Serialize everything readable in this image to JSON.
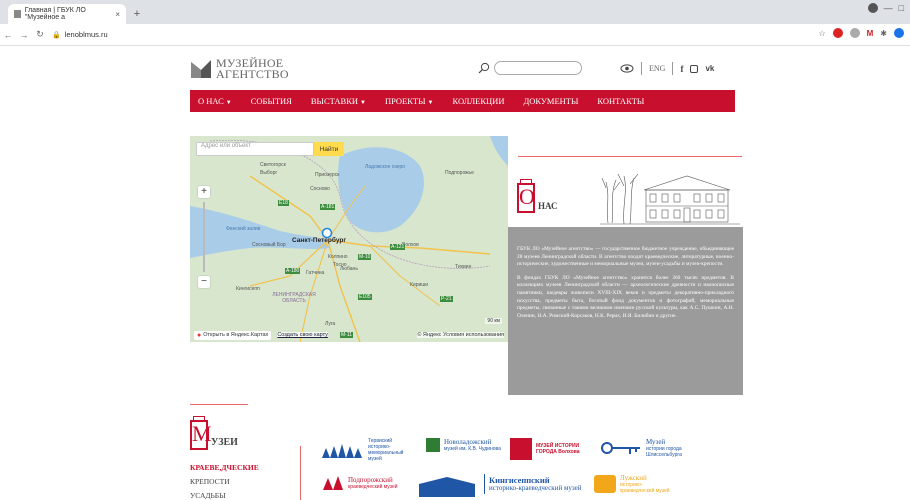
{
  "browser": {
    "tab_title": "Главная | ГБУК ЛО \"Музейное а",
    "tab_close": "×",
    "new_tab": "+",
    "url": "lenoblmus.ru"
  },
  "site": {
    "logo_line1": "МУЗЕЙНОЕ",
    "logo_line2": "АГЕНТСТВО",
    "lang": "ENG",
    "menu": [
      {
        "label": "О НАС",
        "caret": "▼"
      },
      {
        "label": "СОБЫТИЯ",
        "caret": ""
      },
      {
        "label": "ВЫСТАВКИ",
        "caret": "▼"
      },
      {
        "label": "ПРОЕКТЫ",
        "caret": "▼"
      },
      {
        "label": "КОЛЛЕКЦИИ",
        "caret": ""
      },
      {
        "label": "ДОКУМЕНТЫ",
        "caret": ""
      },
      {
        "label": "КОНТАКТЫ",
        "caret": ""
      }
    ]
  },
  "map": {
    "search_placeholder": "Адрес или объект",
    "search_button": "Найти",
    "zoom_in": "+",
    "zoom_out": "−",
    "open_in_yandex": "Открыть в Яндекс.Картах",
    "create_map": "Создать свою карту",
    "copyright": "© Яндекс Условия использования",
    "scale": "90 км",
    "labels": {
      "vyborg": "Выборг",
      "svetogorsk": "Светогорск",
      "sosnovo": "Сосново",
      "priozersk": "Приозерск",
      "ladoga": "Ладожское озеро",
      "podporozhye": "Подпорожье",
      "gulf": "Финский залив",
      "sosnovy_bor": "Сосновый Бор",
      "spb": "Санкт-Петербург",
      "kolpino": "Колпино",
      "lyuban": "Любань",
      "tosno": "Тосно",
      "volkhov": "Волхов",
      "tikhvin": "Тихвин",
      "gatchina": "Гатчина",
      "kingisepp": "Кингисепп",
      "region": "ЛЕНИНГРАДСКАЯ ОБЛАСТЬ",
      "luga": "Луга",
      "kirishi": "Кириши",
      "r_e18": "E18",
      "r_a181": "А-181",
      "r_a121": "А-121",
      "r_m11": "М-11",
      "r_e105": "E105",
      "r_a180": "А-180",
      "r_r21": "Р-21",
      "r_m10": "М-10"
    }
  },
  "about": {
    "letter": "О",
    "rest": "НАС",
    "p1": "ГБУК ЛО «Музейное агентство» — государственное бюджетное учреждение, объединяющее 28 музеев Ленинградской области. В агентство входят краеведческие, литературные, военно-исторические, художественные и мемориальные музеи, музеи-усадьбы и музеи-крепости.",
    "p2": "В фондах ГБУК ЛО «Музейное агентство» хранится более 360 тысяч предметов. В коллекциях музеев Ленинградской области — археологические древности и иконописные памятники, шедевры живописи XVIII-XIX веков и предметы декоративно-прикладного искусства, предметы быта, богатый фонд документов и фотографий, мемориальные предметы, связанные с такими великими именами русской культуры, как А.С. Пушкин, А.Н. Оленин, Н.А. Римский-Корсаков, Н.К. Рерих, И.Я. Билибин и другие."
  },
  "museums": {
    "letter": "М",
    "rest": "УЗЕИ",
    "categories": [
      "КРАЕВЕ,ДЧЕСКИЕ",
      "КРЕПОСТИ",
      "УСАДЬБЫ"
    ],
    "logos": [
      {
        "big": "",
        "small": "Тервиский историко-мемориальный музей"
      },
      {
        "big": "Новоладожский",
        "small": "музей им. К.В. Чудинова"
      },
      {
        "big": "МУЗЕЙ ИСТОРИИ ГОРОДА Волхова",
        "small": ""
      },
      {
        "big": "Музей",
        "small": "истории города Шлиссельбурга"
      },
      {
        "big": "Подпорожский",
        "small": "краеведческий музей"
      },
      {
        "big": "Кингисеппский",
        "small": "историко-краеведческий музей"
      },
      {
        "big": "Лужский",
        "small": "историко-краеведческий музей"
      }
    ]
  }
}
